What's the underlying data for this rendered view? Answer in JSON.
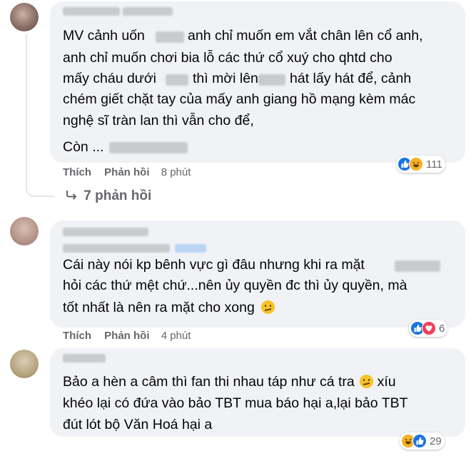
{
  "comments": [
    {
      "lines": [
        "MV cảnh uốn",
        "anh chỉ muốn em vắt chân lên cổ anh,",
        "anh chỉ muốn chơi bia lỗ các thứ cổ xuý cho qhtd cho",
        "mấy cháu dưới",
        "thì mời lên",
        "hát lấy hát để, cảnh",
        "chém giết chặt tay của mấy anh giang hồ mạng kèm mác",
        "nghệ sĩ tràn lan thì vẫn cho để,",
        "Còn ..."
      ],
      "like_label": "Thích",
      "reply_label": "Phản hồi",
      "time": "8 phút",
      "reaction_count": "111",
      "reaction_icons": [
        "like-icon",
        "haha-icon"
      ],
      "replies_label": "7 phản hồi"
    },
    {
      "lines": [
        "Cái này nói kp bênh vực gì đâu nhưng khi ra mặt",
        "hỏi các thứ mệt chứ...nên ủy quyền đc thì ủy quyền, mà",
        "tốt nhất là nên ra mặt cho xong"
      ],
      "emoji": "confused-face-emoji",
      "like_label": "Thích",
      "reply_label": "Phản hồi",
      "time": "4 phút",
      "reaction_count": "6",
      "reaction_icons": [
        "like-icon",
        "heart-icon"
      ]
    },
    {
      "lines": [
        "Bảo a hèn a câm thì fan thi nhau táp như cá tra",
        "xíu",
        "khéo lại có đứa vào bảo TBT mua báo hại a,lại bảo TBT",
        "đút lót bộ Văn Hoá hại a"
      ],
      "emoji": "confused-face-emoji",
      "reaction_count": "29",
      "reaction_icons": [
        "haha-icon",
        "like-icon"
      ]
    }
  ],
  "colors": {
    "bubble": "#f0f2f5",
    "meta": "#65676b",
    "like": "#1b74e4",
    "haha": "#f7b125",
    "heart": "#f33e58"
  }
}
